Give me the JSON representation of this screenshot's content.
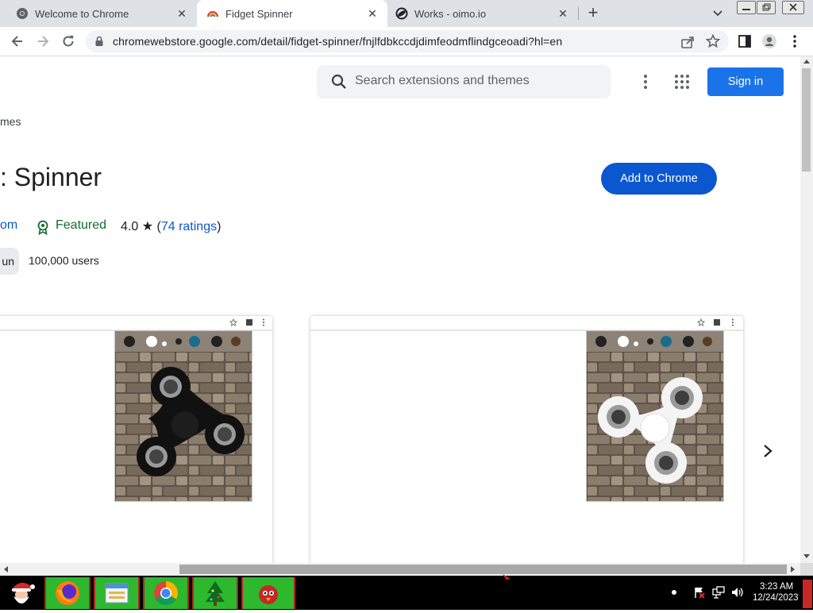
{
  "browser": {
    "tabs": [
      {
        "title": "Welcome to Chrome",
        "favicon": "chrome-icon",
        "active": false
      },
      {
        "title": "Fidget Spinner",
        "favicon": "rainbow-icon",
        "active": true
      },
      {
        "title": "Works - oimo.io",
        "favicon": "oimo-icon",
        "active": false
      }
    ],
    "new_tab": "+",
    "close_glyph": "✕",
    "url": "chromewebstore.google.com/detail/fidget-spinner/fnjlfdbkccdjdimfeodmflindgceoadi?hl=en"
  },
  "store": {
    "search_placeholder": "Search extensions and themes",
    "sign_in": "Sign in",
    "breadcrumb": "mes",
    "title": ": Spinner",
    "add_button": "Add to Chrome",
    "developer": "om",
    "featured": "Featured",
    "rating_value": "4.0",
    "rating_star": "★",
    "ratings_open": "(",
    "ratings_link": "74 ratings",
    "ratings_close": ")",
    "category_chip": "un",
    "users": "100,000 users"
  },
  "taskbar": {
    "time": "3:23 AM",
    "date": "12/24/2023",
    "apps": [
      "santa-icon",
      "firefox-icon",
      "file-manager-icon",
      "chrome-icon",
      "tree-icon",
      "red-bird-icon"
    ]
  },
  "colors": {
    "accent_blue": "#1a73e8",
    "add_button_blue": "#0b57d0",
    "featured_green": "#146c2e",
    "taskbar_green": "#2db82d"
  }
}
